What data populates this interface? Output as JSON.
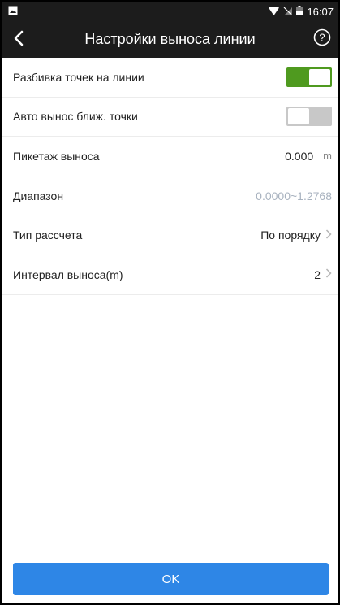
{
  "status": {
    "time": "16:07",
    "icons": [
      "image-icon",
      "wifi-icon",
      "no-sim-icon",
      "battery-icon"
    ]
  },
  "header": {
    "title": "Настройки выноса линии",
    "back_icon": "chevron-left-icon",
    "help_icon": "help-circle-icon"
  },
  "settings": [
    {
      "label": "Разбивка точек на линии",
      "type": "toggle",
      "enabled": true
    },
    {
      "label": "Авто вынос ближ. точки",
      "type": "toggle",
      "enabled": false
    },
    {
      "label": "Пикетаж выноса",
      "value": "0.000",
      "unit": "m"
    },
    {
      "label": "Диапазон",
      "value": "0.0000~1.2768"
    },
    {
      "label": "Тип рассчета",
      "value": "По порядку"
    },
    {
      "label": "Интервал выноса(m)",
      "value": "2"
    }
  ],
  "footer": {
    "ok_label": "OK"
  },
  "colors": {
    "accent": "#2e86e6",
    "toggle_on": "#4f9a1f",
    "toggle_off": "#c8c8c8",
    "bar": "#1c1c1c"
  }
}
